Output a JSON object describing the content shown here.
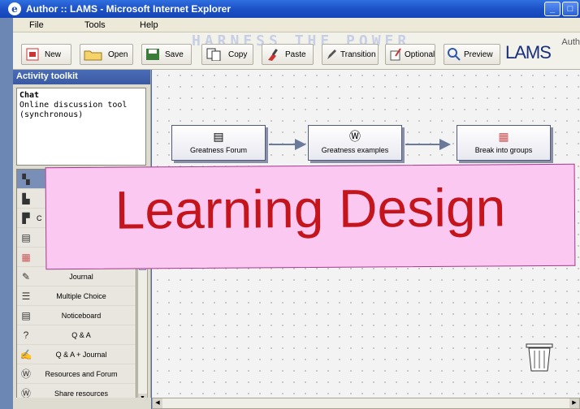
{
  "window": {
    "title": "Author :: LAMS - Microsoft Internet Explorer"
  },
  "menu": [
    "File",
    "Tools",
    "Help"
  ],
  "toolbar": {
    "banner": "HARNESS THE POWER",
    "author_label": "Auth",
    "buttons": [
      "New",
      "Open",
      "Save",
      "Copy",
      "Paste",
      "Transition",
      "Optional",
      "Preview"
    ],
    "logo": "LAMS"
  },
  "toolkit": {
    "header": "Activity toolkit",
    "description_title": "Chat",
    "description": "Online discussion tool (synchronous)",
    "tools": [
      "",
      "",
      "C",
      "",
      "",
      "Journal",
      "Multiple Choice",
      "Noticeboard",
      "Q & A",
      "Q & A + Journal",
      "Resources and Forum",
      "Share resources"
    ]
  },
  "canvas": {
    "activities": [
      "Greatness Forum",
      "Greatness examples",
      "Break into groups"
    ]
  },
  "overlay": {
    "text": "Learning Design"
  }
}
